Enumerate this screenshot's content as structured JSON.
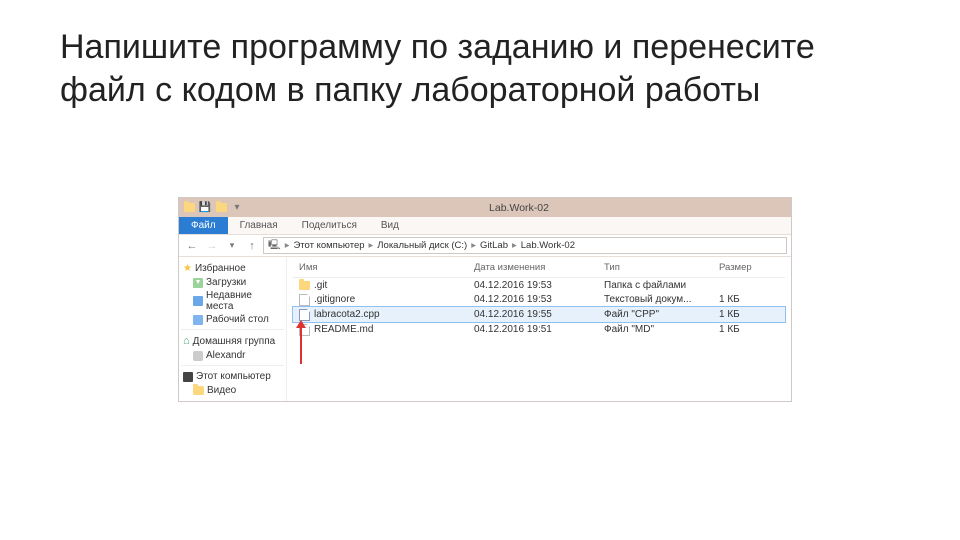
{
  "slide": {
    "title": "Напишите программу по заданию и перенесите файл с кодом в папку лабораторной работы"
  },
  "window": {
    "title": "Lab.Work-02"
  },
  "ribbon": {
    "tabs": [
      "Файл",
      "Главная",
      "Поделиться",
      "Вид"
    ]
  },
  "breadcrumb": {
    "items": [
      "Этот компьютер",
      "Локальный диск (C:)",
      "GitLab",
      "Lab.Work-02"
    ]
  },
  "sidebar": {
    "favorites": "Избранное",
    "downloads": "Загрузки",
    "recent": "Недавние места",
    "desktop": "Рабочий стол",
    "homegroup": "Домашняя группа",
    "user": "Alexandr",
    "thispc": "Этот компьютер",
    "videos": "Видео"
  },
  "columns": {
    "name": "Имя",
    "date": "Дата изменения",
    "type": "Тип",
    "size": "Размер"
  },
  "rows": [
    {
      "name": ".git",
      "date": "04.12.2016 19:53",
      "type": "Папка с файлами",
      "size": ""
    },
    {
      "name": ".gitignore",
      "date": "04.12.2016 19:53",
      "type": "Текстовый докум...",
      "size": "1 КБ"
    },
    {
      "name": "labracota2.cpp",
      "date": "04.12.2016 19:55",
      "type": "Файл \"CPP\"",
      "size": "1 КБ"
    },
    {
      "name": "README.md",
      "date": "04.12.2016 19:51",
      "type": "Файл \"MD\"",
      "size": "1 КБ"
    }
  ]
}
